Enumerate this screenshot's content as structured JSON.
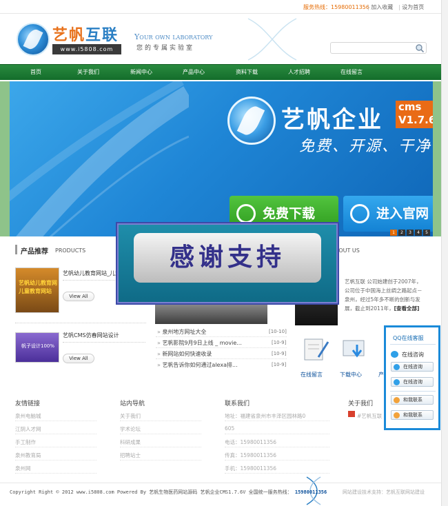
{
  "topbar": {
    "hotline_label": "服务热线：15980011356",
    "favorite": "加入收藏",
    "sethome": "设为首页"
  },
  "header": {
    "logo_cn_a": "艺帆",
    "logo_cn_b": "互联",
    "logo_url": "www.i5808.com",
    "slogan_en": "Your own laboratory",
    "slogan_cn": "您的专属实验室",
    "search_placeholder": ""
  },
  "nav": {
    "items": [
      "首页",
      "关于我们",
      "新闻中心",
      "产品中心",
      "资料下载",
      "人才招聘",
      "在线留言"
    ]
  },
  "banner": {
    "title": "艺帆企业",
    "badge_line1": "cms",
    "badge_line2": "V1.7.6",
    "tagline": "免费、开源、干净",
    "download": "免费下载",
    "site": "进入官网",
    "pages": [
      "1",
      "2",
      "3",
      "4",
      "5"
    ],
    "active_page": 1
  },
  "products": {
    "title": "产品推荐",
    "subtitle": "PRODUCTS",
    "items": [
      {
        "name": "艺帆幼儿教育网站_儿童...",
        "thumb": "艺帆幼儿教育网 儿童教育网站",
        "view": "View All"
      },
      {
        "name": "艺帆CMS仿春网站设计",
        "thumb": "帆子设计100%",
        "view": "View All"
      }
    ]
  },
  "news": {
    "items": [
      {
        "title": "泉州地方网址大全",
        "date": "[10-10]"
      },
      {
        "title": "艺帆影院9月9日上线 _ movie...",
        "date": "[10-9]"
      },
      {
        "title": "新网站如何快速收录",
        "date": "[10-9]"
      },
      {
        "title": "艺帆告诉你如何通过alexa排...",
        "date": "[10-9]"
      }
    ]
  },
  "about": {
    "title_tail": "BOUT US",
    "text": "艺帆互联 公司始建创于2007年，公司位于中国海上丝绸之路起点－泉州，经过5年多不断的创新与发展，截止到2011年，",
    "more": "[查看全部]"
  },
  "quick": {
    "items": [
      "在线留言",
      "下载中心",
      "产"
    ]
  },
  "thanks": "感谢支持",
  "footer": {
    "columns": [
      {
        "title": "友情链接",
        "links": [
          "泉州电脑城",
          "江阴人才网",
          "手工制作",
          "泉州教育局",
          "泉州网"
        ]
      },
      {
        "title": "站内导航",
        "links": [
          "关于我们",
          "学术论坛",
          "科研成果",
          "招聘站士"
        ]
      },
      {
        "title": "联系我们",
        "links": [
          "地址：福建省泉州市丰泽区园林路0",
          "605",
          "电话：15980011356",
          "传真：15980011356",
          "手机：15980011356"
        ]
      },
      {
        "title": "关于我们",
        "links": [
          "#艺帆互联"
        ]
      }
    ],
    "copyright": "Copyright Right © 2012 www.i5808.com Powered By 艺帆生物医药网站源码 艺帆企业CMS1.7.6V 全国统一服务热线：",
    "hotline": "15980011356",
    "credit": "网站建设技术支持：艺帆互联网站建设"
  },
  "qq": {
    "title": "QQ在线客服",
    "head": "在线咨询",
    "buttons": [
      "在线咨询",
      "在线咨询"
    ],
    "orange": [
      "和我联系",
      "和我联系"
    ]
  }
}
